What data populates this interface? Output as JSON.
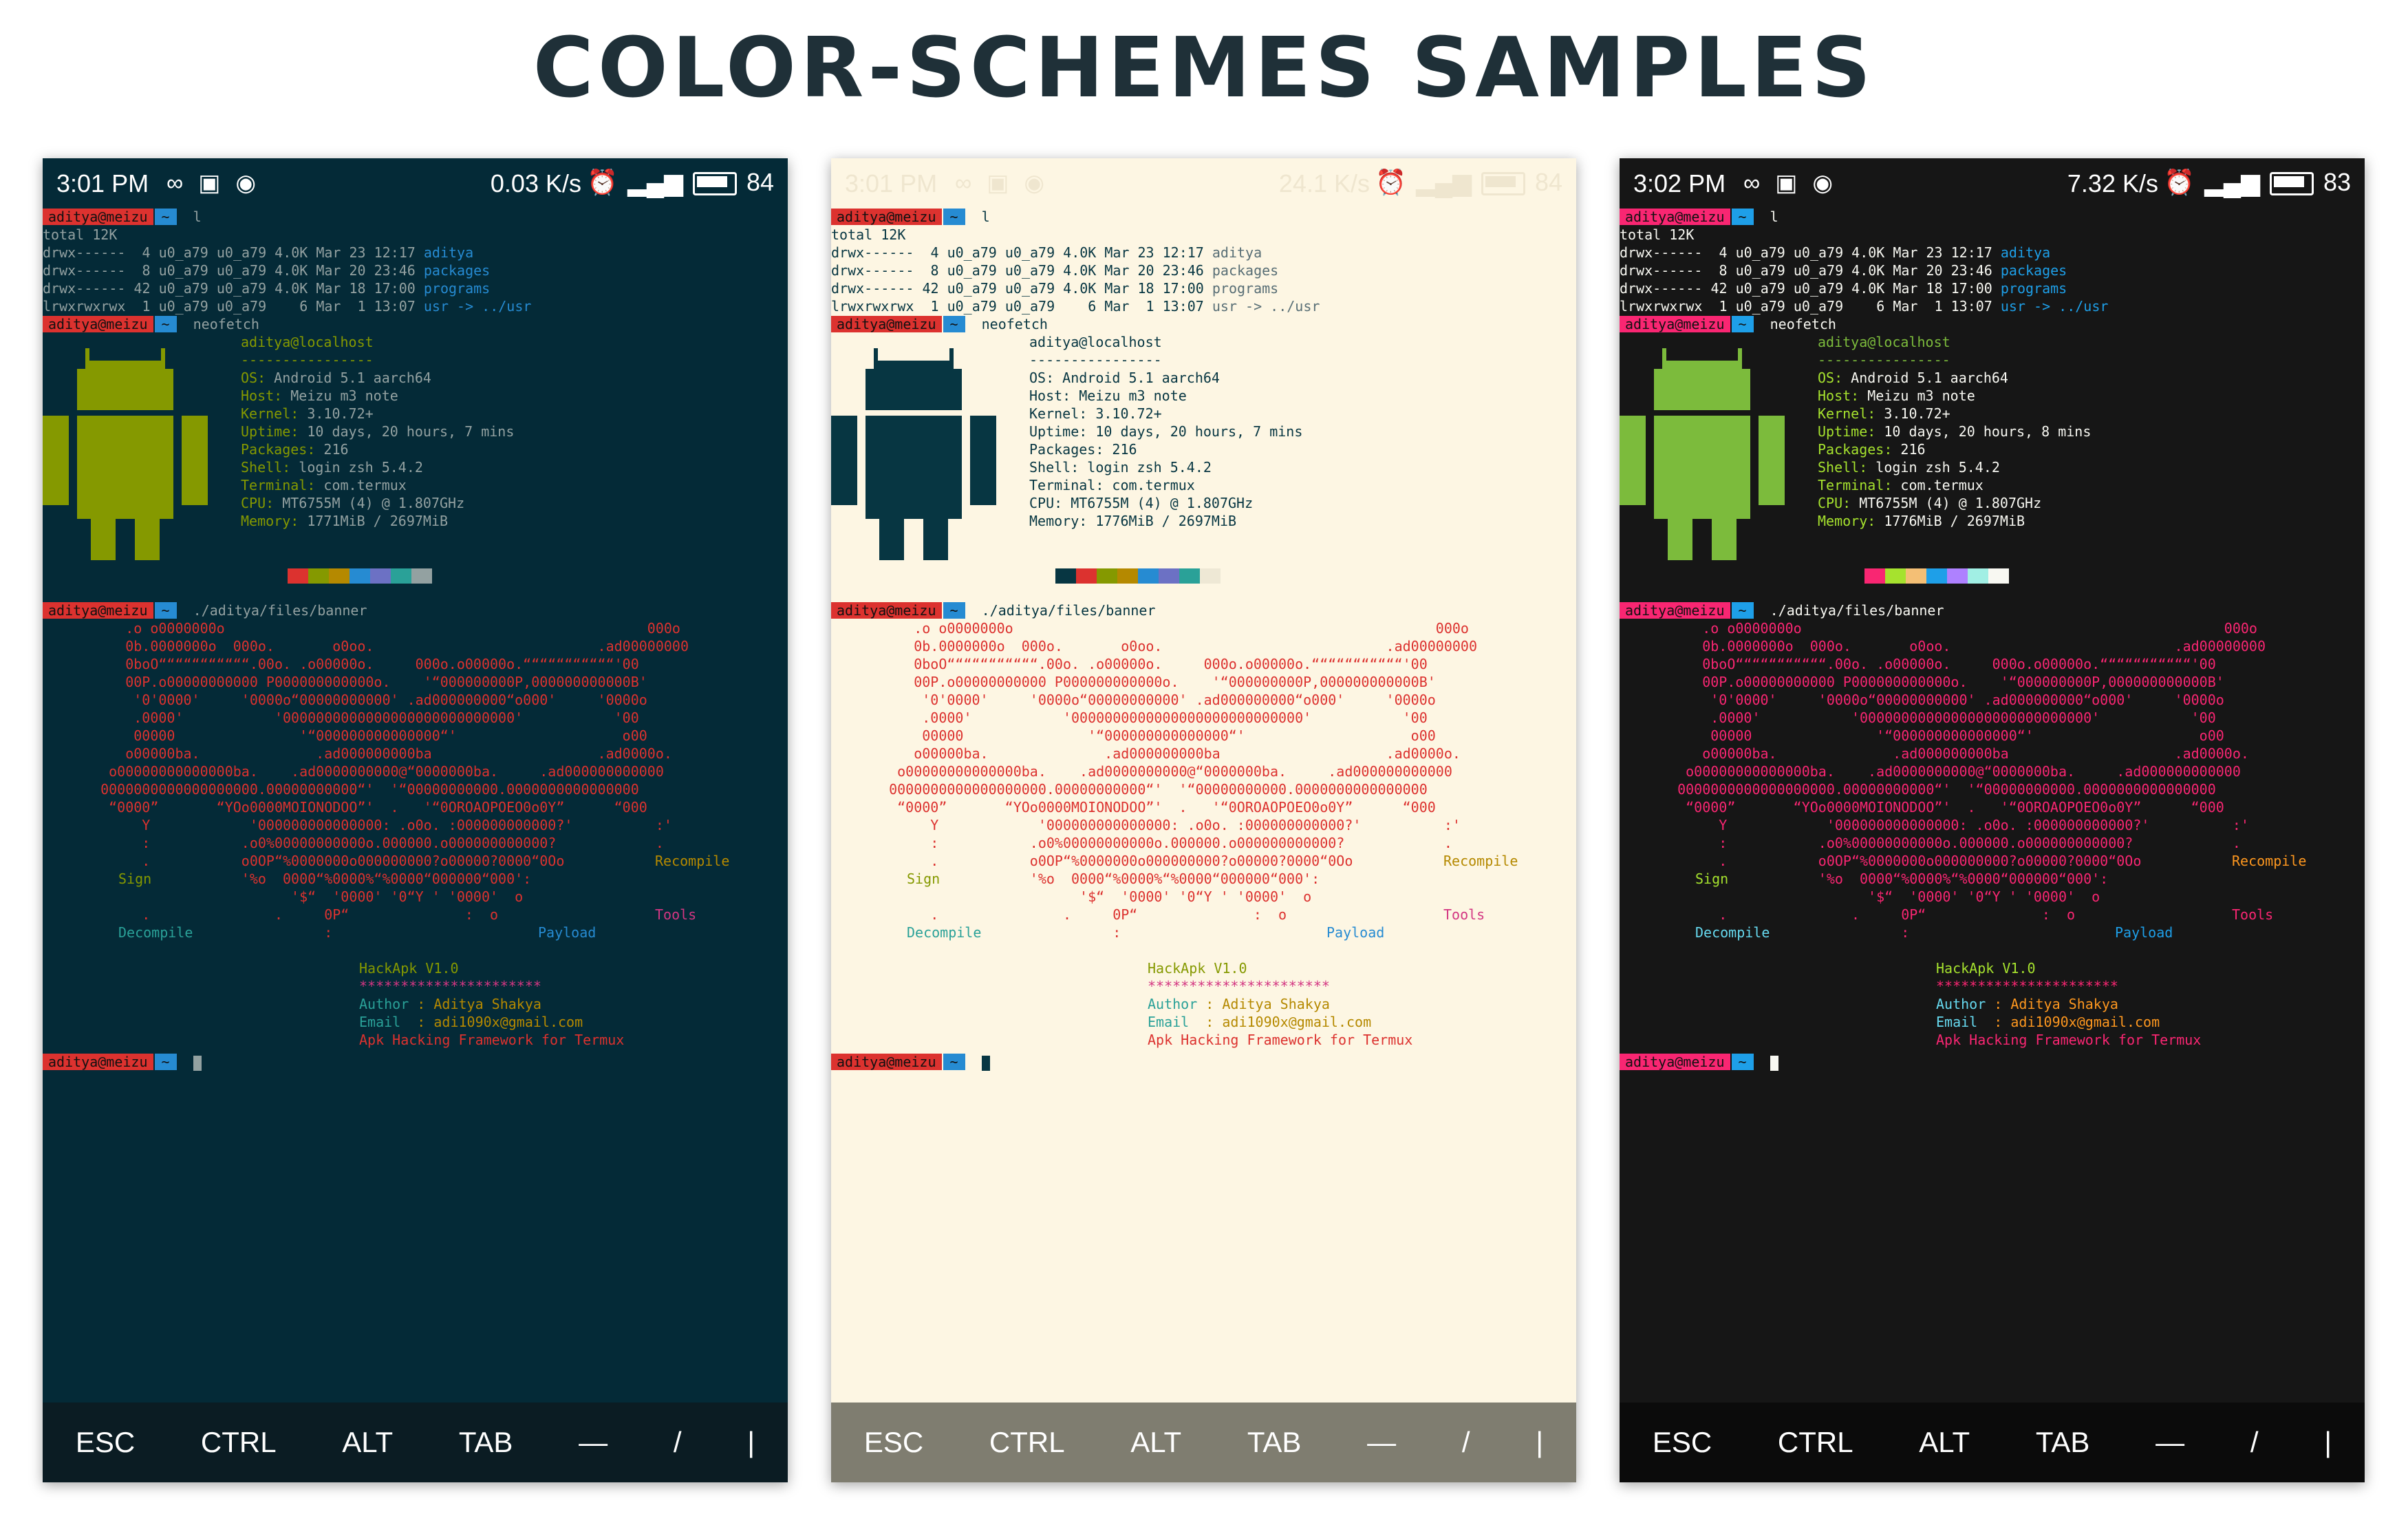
{
  "title": "COLOR-SCHEMES SAMPLES",
  "icons": [
    "infinity-icon",
    "image-notification-icon",
    "hotspot-icon",
    "alarm-icon",
    "4g-signal-icon",
    "battery-icon"
  ],
  "screens": [
    {
      "name": "solarized-dark",
      "status": {
        "time": "3:01 PM",
        "speed": "0.03 K/s",
        "battery": "84"
      },
      "colors": {
        "bg": "#042a37",
        "fg": "#93a1a1",
        "dir": "#268bd2",
        "red": "#dc322f",
        "green": "#859900",
        "yellow": "#b58900",
        "blue": "#268bd2",
        "magenta": "#d33682",
        "cyan": "#2aa198",
        "android": "#859900",
        "info_key": "#859900"
      },
      "swatches": [
        "#042a37",
        "#dc322f",
        "#859900",
        "#b58900",
        "#268bd2",
        "#6c71c4",
        "#2aa198",
        "#93a1a1"
      ],
      "memory": "1771MiB / 2697MiB",
      "uptime": "10 days, 20 hours, 7 mins"
    },
    {
      "name": "solarized-light",
      "status": {
        "time": "3:01 PM",
        "speed": "24.1 K/s",
        "battery": "84"
      },
      "colors": {
        "bg": "#fdf6e3",
        "fg": "#073642",
        "dir": "#586e75",
        "red": "#dc322f",
        "green": "#859900",
        "yellow": "#b58900",
        "blue": "#268bd2",
        "magenta": "#d33682",
        "cyan": "#2aa198",
        "android": "#073642",
        "info_key": "#073642"
      },
      "swatches": [
        "#073642",
        "#dc322f",
        "#859900",
        "#b58900",
        "#268bd2",
        "#6c71c4",
        "#2aa198",
        "#eee8d5"
      ],
      "memory": "1776MiB / 2697MiB",
      "uptime": "10 days, 20 hours, 7 mins"
    },
    {
      "name": "monokai",
      "status": {
        "time": "3:02 PM",
        "speed": "7.32 K/s",
        "battery": "83"
      },
      "colors": {
        "bg": "#161616",
        "fg": "#f8f8f2",
        "dir": "#1e9fe8",
        "red": "#f92672",
        "green": "#a6e22e",
        "yellow": "#fd971f",
        "blue": "#1e9fe8",
        "magenta": "#f92672",
        "cyan": "#66d9ef",
        "android": "#7cbb3c",
        "info_key": "#a6e22e"
      },
      "swatches": [
        "#161616",
        "#f92672",
        "#a6e22e",
        "#f4bf75",
        "#1e9fe8",
        "#ae81ff",
        "#a1efe4",
        "#f8f8f2"
      ],
      "memory": "1776MiB / 2697MiB",
      "uptime": "10 days, 20 hours, 8 mins"
    }
  ],
  "terminal": {
    "prompt_user": "aditya@meizu",
    "prompt_dir": "~",
    "cmd_ls": "l",
    "ls_total": "total 12K",
    "ls_rows": [
      {
        "perm": "drwx------  4 u0_a79 u0_a79 4.0K Mar 23 12:17 ",
        "name": "aditya",
        "link": ""
      },
      {
        "perm": "drwx------  8 u0_a79 u0_a79 4.0K Mar 20 23:46 ",
        "name": "packages",
        "link": ""
      },
      {
        "perm": "drwx------ 42 u0_a79 u0_a79 4.0K Mar 18 17:00 ",
        "name": "programs",
        "link": ""
      },
      {
        "perm": "lrwxrwxrwx  1 u0_a79 u0_a79    6 Mar  1 13:07 ",
        "name": "usr",
        "link": " -> ../usr"
      }
    ],
    "cmd_neofetch": "neofetch",
    "neofetch": {
      "user_host": "aditya@localhost",
      "sep": "----------------",
      "os": "Android 5.1 aarch64",
      "host": "Meizu m3 note",
      "kernel": "3.10.72+",
      "packages": "216",
      "shell": "login zsh 5.4.2",
      "terminal": "com.termux",
      "cpu": "MT6755M (4) @ 1.807GHz"
    },
    "labels": {
      "os": "OS",
      "host": "Host",
      "kernel": "Kernel",
      "uptime": "Uptime",
      "packages": "Packages",
      "shell": "Shell",
      "terminal": "Terminal",
      "cpu": "CPU",
      "memory": "Memory"
    },
    "cmd_banner": "./aditya/files/banner",
    "banner_art": [
      "     .o o0000000o                                                   000o",
      "     0b.0000000o  000o.       o0oo.                           .ad00000000",
      "     0boO“““““““““““.00o. .o00000o.     000o.o00000o.“““““““““““'00",
      "     00P.o00000000000 P000000000000o.    '“000000000P,000000000000B'",
      "      '0'0000'     '0000o“00000000000' .ad000000000“o000'     '0000o",
      "      .0000'           '0000000000000000000000000000'           '00",
      "      00000               '“000000000000000“'                    o00",
      "     o00000ba.              .ad000000000ba                    .ad0000o.",
      "   o00000000000000ba.    .ad0000000000@“0000000ba.     .ad000000000000",
      "  0000000000000000000.00000000000“'  '“00000000000.0000000000000000",
      "   “0000”       “YOo0000MOIONODOO”'  .   '“0OROAOPOEO0o0Y”      “000",
      "       Y            '000000000000000: .o0o. :000000000000?'          :'",
      "       :           .o0%00000000000o.000000.o000000000000?            .",
      "       .           o0OP“%0000000o000000000?o00000?0000“0Oo",
      "                   '%o  0000“%0000%“%0000“000000“000':",
      "                         '$“  '0000' '0“Y ' '0000'  o",
      "       .               .     0P“              :  o",
      "                             :"
    ],
    "recompile": "Recompile",
    "sign": "Sign",
    "tools": "Tools",
    "decompile": "Decompile",
    "payload": "Payload",
    "hackapk": "HackApk V1.0",
    "stars": "**********************",
    "author_label": "Author",
    "author": "Aditya Shakya",
    "email_label": "Email ",
    "email": "adi1090x@gmail.com",
    "tagline": "Apk Hacking Framework for Termux"
  },
  "keys": [
    "ESC",
    "CTRL",
    "ALT",
    "TAB",
    "—",
    "/",
    "|"
  ]
}
